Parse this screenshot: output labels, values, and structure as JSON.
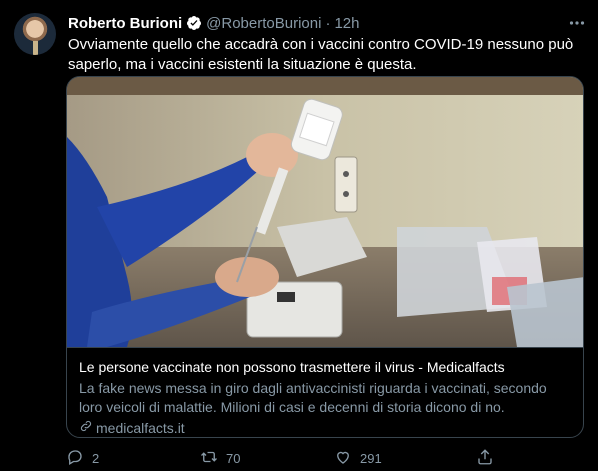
{
  "tweet": {
    "author_name": "Roberto Burioni",
    "author_handle": "@RobertoBurioni",
    "separator": "·",
    "time": "12h",
    "text": "Ovviamente quello che accadrà con i vaccini contro COVID-19 nessuno può saperlo, ma i vaccini esistenti la situazione è questa."
  },
  "card": {
    "title": "Le persone vaccinate non possono trasmettere il virus - Medicalfacts",
    "description": "La fake news messa in giro dagli antivaccinisti riguarda i vaccinati, secondo loro veicoli di malattie. Milioni di casi e decenni di storia dicono di no.",
    "domain": "medicalfacts.it"
  },
  "actions": {
    "reply_count": "2",
    "retweet_count": "70",
    "like_count": "291"
  },
  "colors": {
    "background": "#000000",
    "secondary_text": "#8899a6",
    "verified": "#ffffff",
    "border": "#38444d"
  },
  "icons": [
    "verified-badge-icon",
    "more-icon",
    "link-icon",
    "reply-icon",
    "retweet-icon",
    "like-icon",
    "share-icon"
  ]
}
